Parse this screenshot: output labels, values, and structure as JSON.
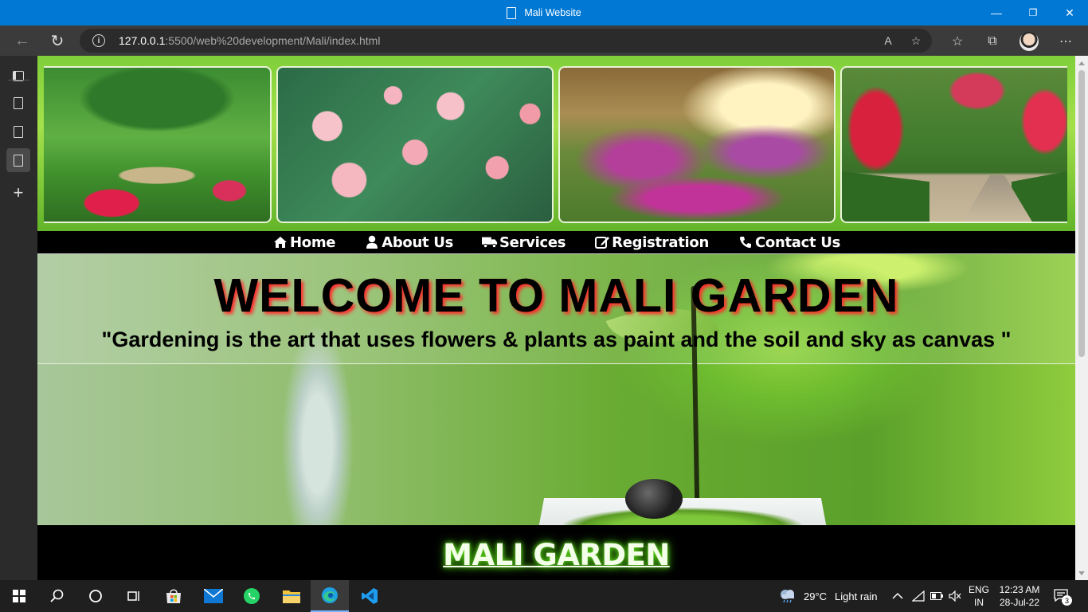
{
  "window": {
    "title": "Mali Website",
    "minimize": "—",
    "restore": "❐",
    "close": "✕"
  },
  "addressbar": {
    "url_host": "127.0.0.1",
    "url_rest": ":5500/web%20development/Mali/index.html"
  },
  "nav": {
    "items": [
      {
        "label": "Home",
        "icon": "home-icon"
      },
      {
        "label": "About Us",
        "icon": "user-icon"
      },
      {
        "label": "Services",
        "icon": "truck-icon"
      },
      {
        "label": "Registration",
        "icon": "edit-icon"
      },
      {
        "label": "Contact Us",
        "icon": "phone-icon"
      }
    ]
  },
  "hero": {
    "title": "WELCOME TO MALI GARDEN",
    "quote": "\"Gardening is the art that uses flowers & plants as paint and the soil and sky as canvas \""
  },
  "footer": {
    "brand": "MALI GARDEN"
  },
  "taskbar": {
    "weather_temp": "29°C",
    "weather_text": "Light rain",
    "lang_top": "ENG",
    "lang_bottom": "IN",
    "time": "12:23 AM",
    "date": "28-Jul-22",
    "notifications": "3"
  },
  "colors": {
    "titlebar": "#0078d4",
    "navbar": "#000000",
    "hero_title_shadow": "#ff2b2b",
    "brand_glow": "#66e020"
  }
}
